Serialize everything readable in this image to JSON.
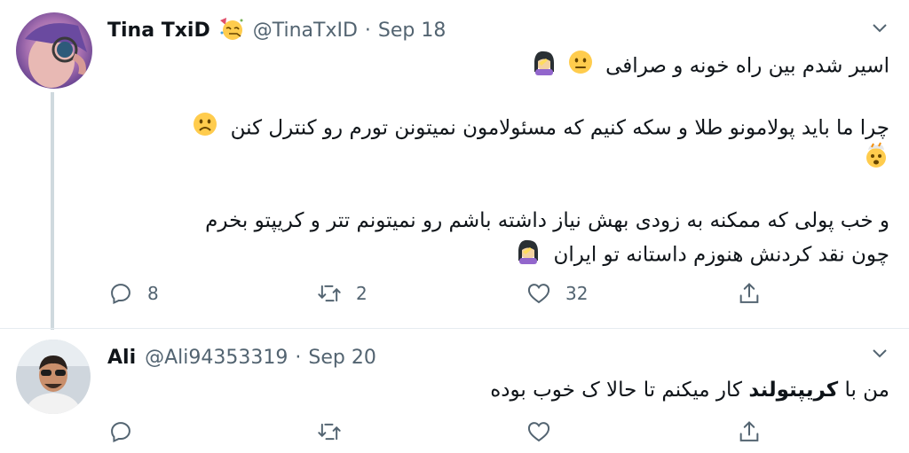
{
  "tweets": [
    {
      "name": "Tina TxiD",
      "handle": "@TinaTxID",
      "separator": "·",
      "date": "Sep 18",
      "lines": [
        "اسیر شدم بین راه خونه و صرافی",
        "چرا ما باید پولامونو طلا و سکه کنیم که مسئولامون نمیتونن تورم رو کنترل کنن",
        "و خب پولی که ممکنه به زودی بهش نیاز داشته باشم رو نمیتونم تتر و کریپتو بخرم",
        "چون نقد کردنش هنوزم داستانه تو ایران"
      ],
      "replies": "8",
      "retweets": "2",
      "likes": "32"
    },
    {
      "name": "Ali",
      "handle": "@Ali94353319",
      "separator": "·",
      "date": "Sep 20",
      "text_before": "من با ",
      "text_bold": "کریپتولند",
      "text_after": " کار میکنم تا حالا ک خوب بوده"
    }
  ],
  "colors": {
    "secondary": "#536471",
    "thread_line": "#cfd9de",
    "text": "#0f1419"
  },
  "icons": [
    "reply-icon",
    "retweet-icon",
    "like-icon",
    "share-icon",
    "chevron-down-icon",
    "partying-face-icon",
    "neutral-face-icon",
    "frowning-face-icon",
    "exploding-head-icon",
    "facepalm-icon"
  ]
}
